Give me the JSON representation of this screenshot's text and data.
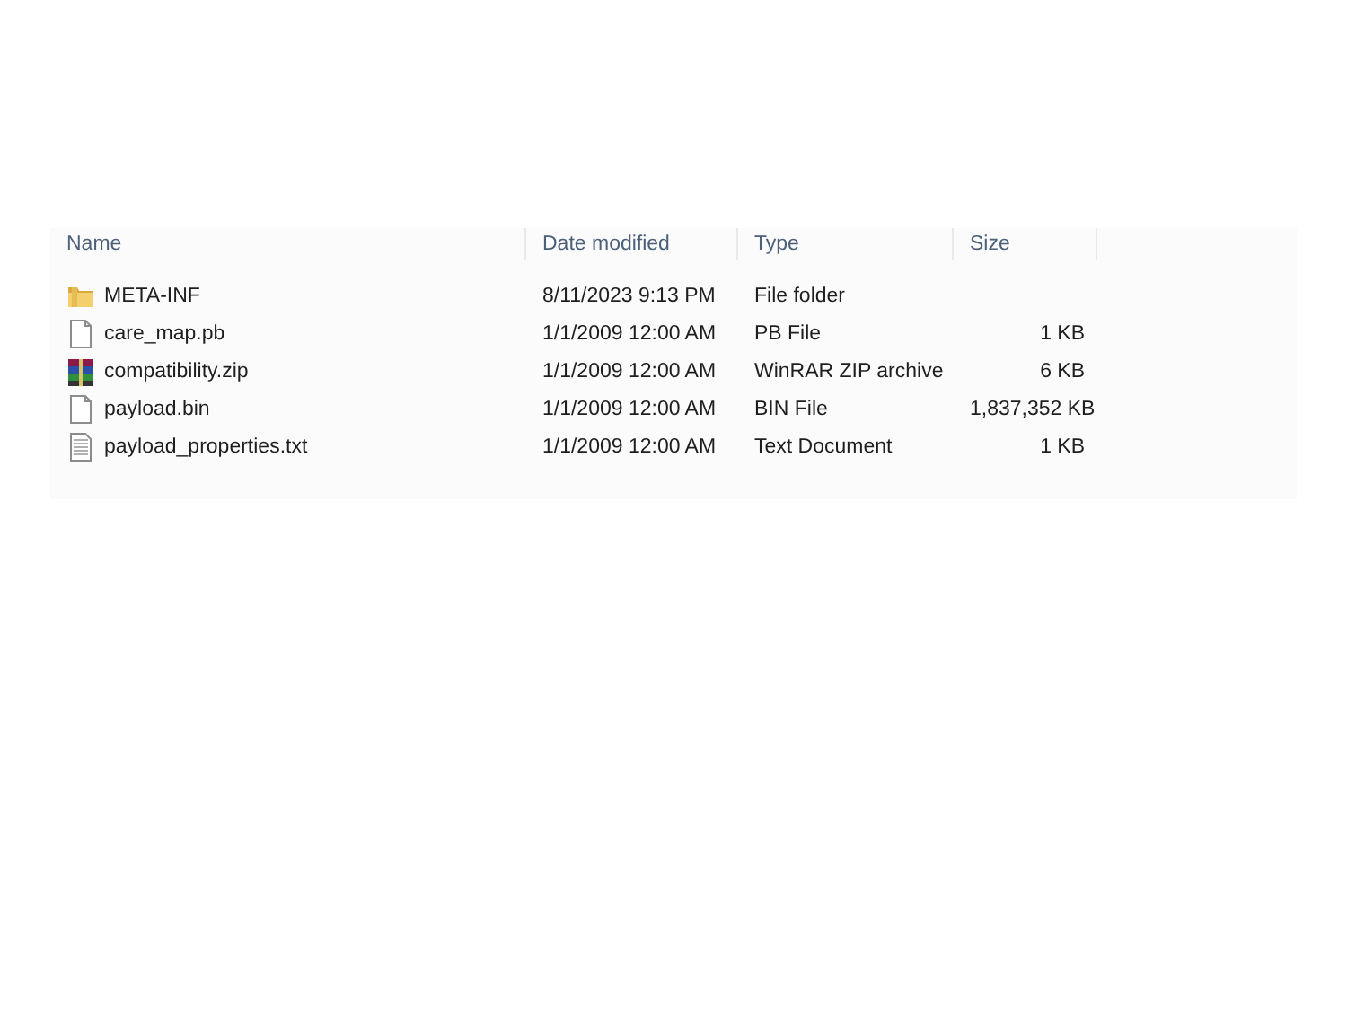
{
  "columns": [
    "Name",
    "Date modified",
    "Type",
    "Size"
  ],
  "rows": [
    {
      "kind": "folder",
      "name": "META-INF",
      "date": "8/11/2023 9:13 PM",
      "type": "File folder"
    },
    {
      "kind": "file",
      "name": "care_map.pb",
      "date": "1/1/2009 12:00 AM",
      "type": "PB File",
      "size": "1 KB"
    },
    {
      "kind": "archive",
      "name": "compatibility.zip",
      "date": "1/1/2009 12:00 AM",
      "type": "WinRAR ZIP archive",
      "size": "6 KB"
    },
    {
      "kind": "file",
      "name": "payload.bin",
      "date": "1/1/2009 12:00 AM",
      "type": "BIN File",
      "size": "1,837,352 KB"
    },
    {
      "kind": "text",
      "name": "payload_properties.txt",
      "date": "1/1/2009 12:00 AM",
      "type": "Text Document",
      "size": "1 KB"
    }
  ]
}
